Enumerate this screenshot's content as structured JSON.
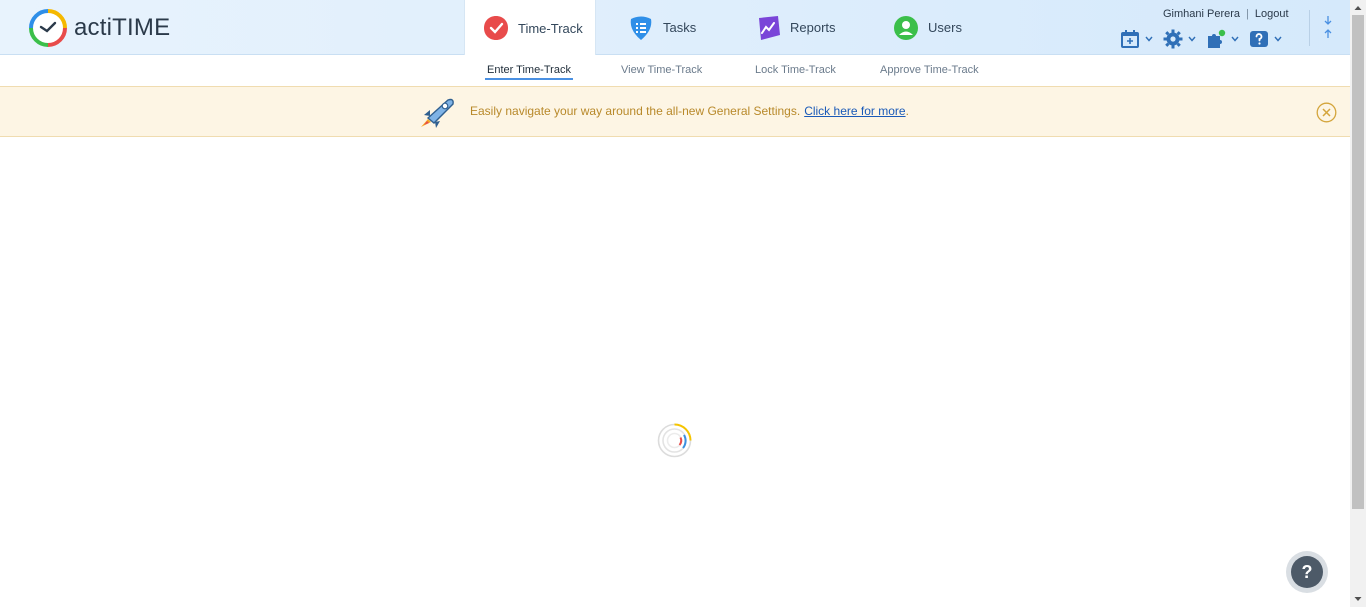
{
  "app": {
    "name": "actiTIME"
  },
  "nav": {
    "tabs": [
      {
        "label": "Time-Track",
        "icon": "check-icon",
        "color": "#e84b4b",
        "active": true
      },
      {
        "label": "Tasks",
        "icon": "list-icon",
        "color": "#2f8fe8",
        "active": false
      },
      {
        "label": "Reports",
        "icon": "chart-icon",
        "color": "#7a45d8",
        "active": false
      },
      {
        "label": "Users",
        "icon": "user-icon",
        "color": "#3bbf4a",
        "active": false
      }
    ]
  },
  "user": {
    "name": "Gimhani Perera",
    "separator": "|",
    "logout_label": "Logout"
  },
  "tools": [
    "calendar-icon",
    "gear-icon",
    "puzzle-icon",
    "help-icon"
  ],
  "subnav": {
    "items": [
      {
        "label": "Enter Time-Track",
        "active": true
      },
      {
        "label": "View Time-Track",
        "active": false
      },
      {
        "label": "Lock Time-Track",
        "active": false
      },
      {
        "label": "Approve Time-Track",
        "active": false
      }
    ]
  },
  "banner": {
    "text": "Easily navigate your way around the all-new General Settings.",
    "link_label": "Click here for more",
    "trailing": "."
  },
  "help_fab": {
    "label": "?"
  },
  "colors": {
    "accent": "#4a90e2",
    "banner_text": "#b8892a",
    "link": "#1a5ab8"
  }
}
